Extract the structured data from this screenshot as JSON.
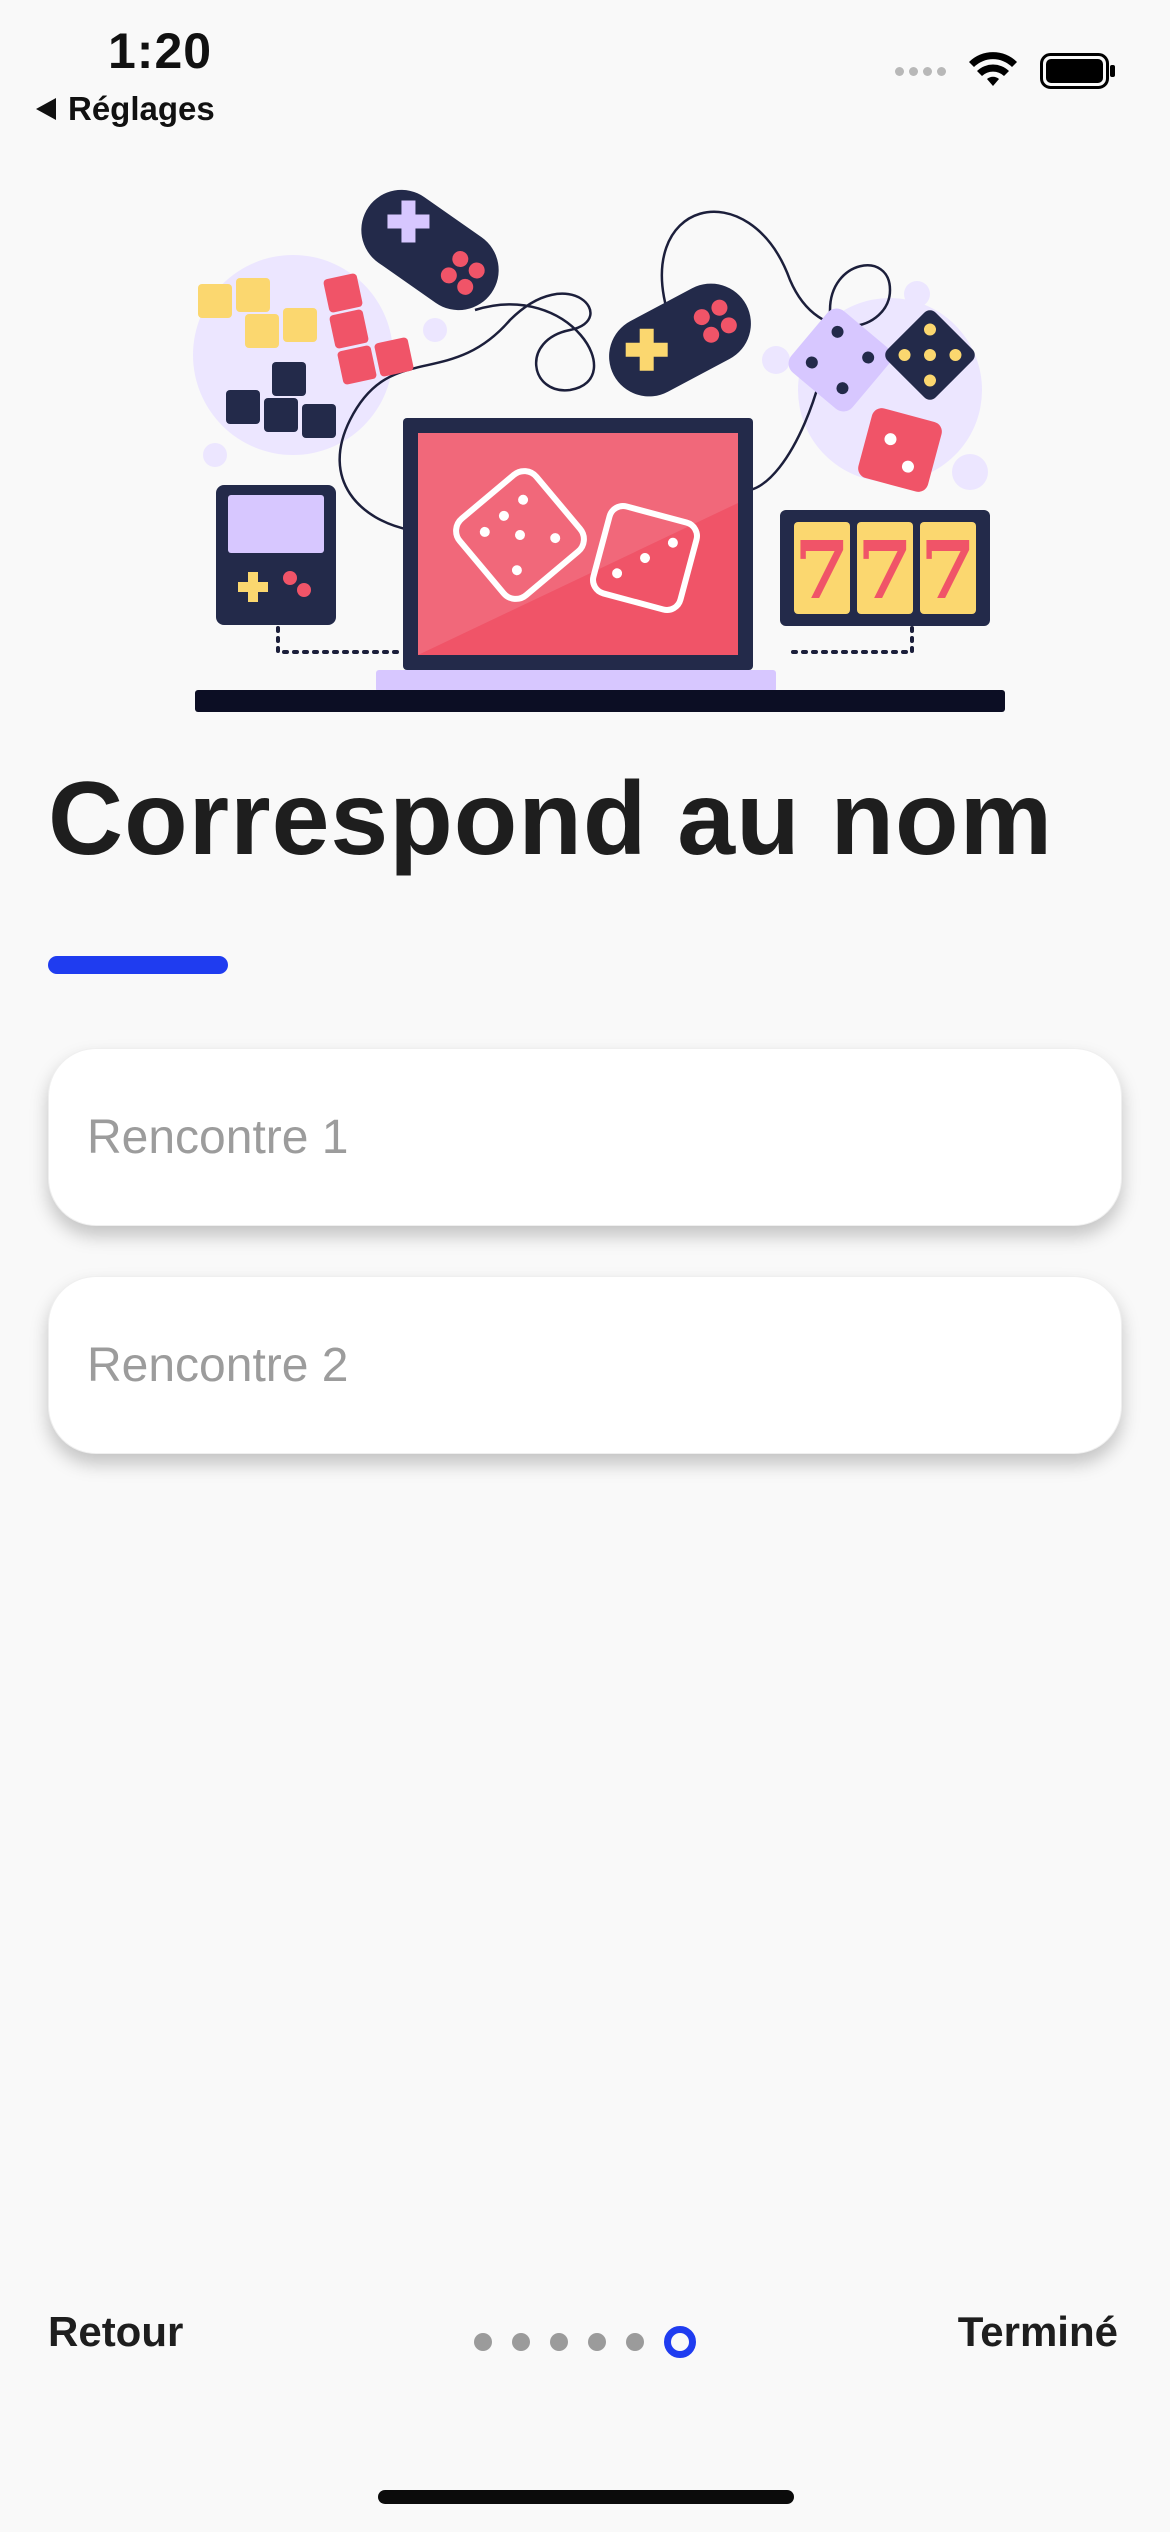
{
  "status_bar": {
    "time": "1:20",
    "back_app": "Réglages"
  },
  "page": {
    "title": "Correspond au nom"
  },
  "fields": [
    {
      "placeholder": "Rencontre 1",
      "value": ""
    },
    {
      "placeholder": "Rencontre 2",
      "value": ""
    }
  ],
  "nav": {
    "back_label": "Retour",
    "done_label": "Terminé",
    "pager": {
      "total": 6,
      "current": 6
    }
  },
  "colors": {
    "accent": "#1f3cf0",
    "text": "#1e1e1e",
    "background": "#f9f9f9"
  }
}
